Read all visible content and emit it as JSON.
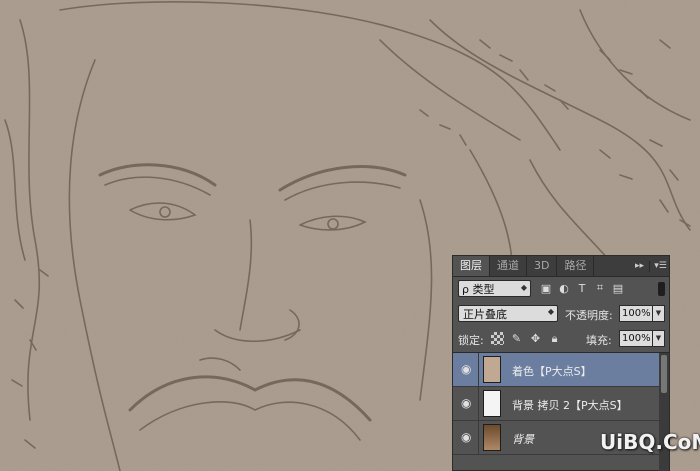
{
  "panel": {
    "tabs": [
      {
        "label": "图层",
        "active": true
      },
      {
        "label": "通道",
        "active": false
      },
      {
        "label": "3D",
        "active": false
      },
      {
        "label": "路径",
        "active": false
      }
    ],
    "collapse_icon": "double-arrow-right-icon",
    "menu_icon": "panel-menu-icon"
  },
  "filter": {
    "kind_label": "ρ 类型",
    "icons": [
      "image-filter-icon",
      "adjustment-filter-icon",
      "type-filter-icon",
      "shape-filter-icon",
      "smart-object-filter-icon"
    ],
    "icon_glyphs": [
      "▣",
      "◐",
      "T",
      "⌗",
      "▤"
    ]
  },
  "blend": {
    "mode": "正片叠底",
    "opacity_label": "不透明度:",
    "opacity_value": "100%"
  },
  "lock": {
    "label": "锁定:",
    "fill_label": "填充:",
    "fill_value": "100%"
  },
  "layers": [
    {
      "name": "着色【P大点S】",
      "selected": true,
      "thumb_color": "#c1a892"
    },
    {
      "name": "背景 拷贝 2【P大点S】",
      "selected": false,
      "thumb_color": "#f4f4f4"
    },
    {
      "name": "背景",
      "selected": false,
      "thumb_color": "#8a6a4a"
    }
  ],
  "watermark": "UiBQ.CoM",
  "colors": {
    "canvas_bg": "#a8998a",
    "line_color": "#6e6154",
    "panel_bg": "#535353",
    "selected_layer": "#6c7ea0"
  }
}
